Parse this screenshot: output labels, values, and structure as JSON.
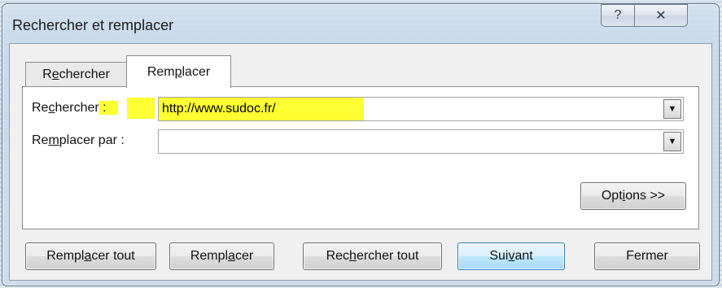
{
  "window": {
    "title": "Rechercher et remplacer",
    "help_glyph": "?",
    "close_glyph": "✕"
  },
  "tabs": [
    {
      "label_pre": "R",
      "label_u": "e",
      "label_post": "chercher"
    },
    {
      "label_pre": "Rem",
      "label_u": "p",
      "label_post": "lacer"
    }
  ],
  "fields": {
    "search_label_pre": "Re",
    "search_label_u": "c",
    "search_label_post": "hercher",
    "search_colon": " :",
    "search_value": "http://www.sudoc.fr/",
    "replace_label_pre": "Re",
    "replace_label_u": "m",
    "replace_label_post": "placer par :",
    "replace_value": ""
  },
  "buttons": {
    "options_pre": "Opt",
    "options_u": "i",
    "options_post": "ons >>",
    "replace_all_pre": "Rempl",
    "replace_all_u": "a",
    "replace_all_post": "cer tout",
    "replace_pre": "Rempl",
    "replace_u": "a",
    "replace_post": "cer",
    "find_all_pre": "Rec",
    "find_all_u": "h",
    "find_all_post": "ercher tout",
    "next_pre": "Sui",
    "next_u": "v",
    "next_post": "ant",
    "close": "Fermer"
  },
  "colors": {
    "highlight": "#ffff33",
    "default_button_border": "#3c7fb1"
  }
}
